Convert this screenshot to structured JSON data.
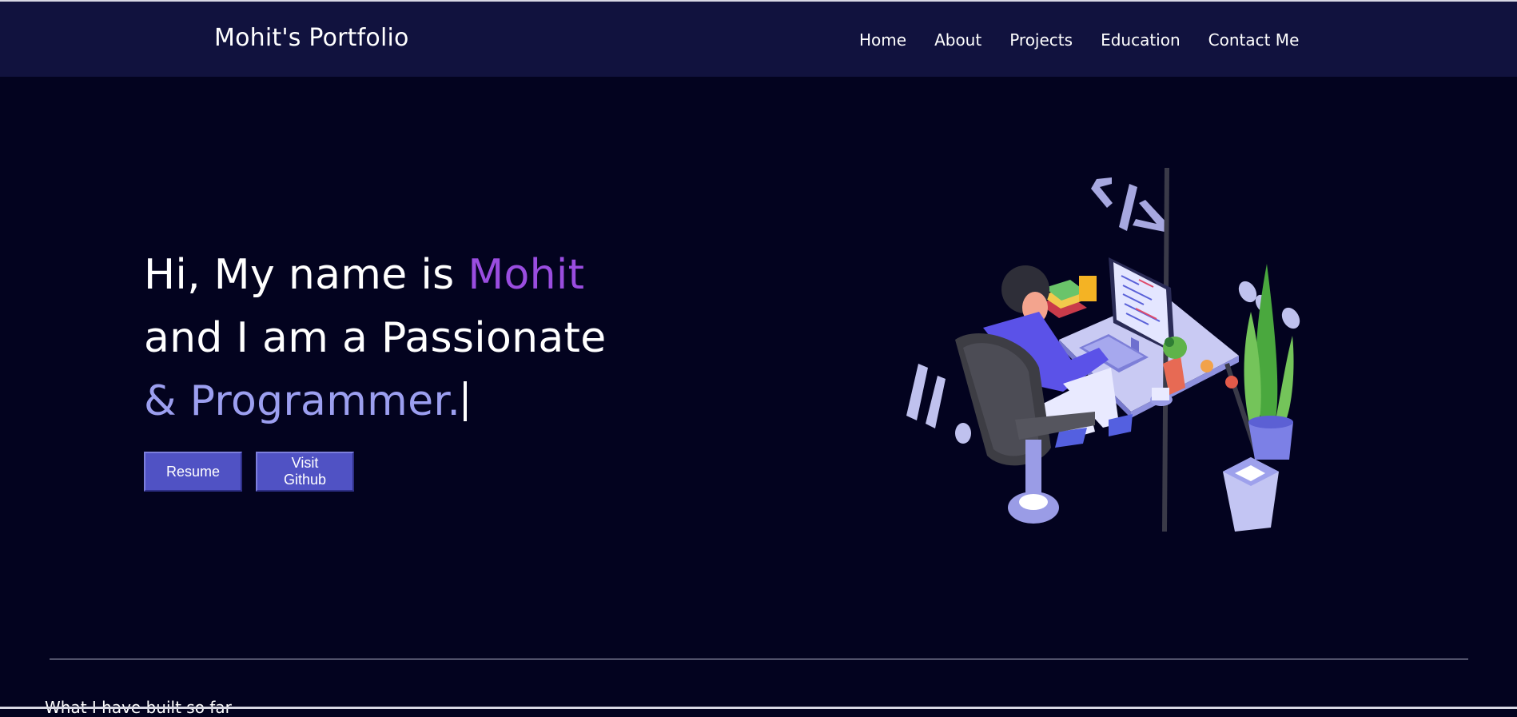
{
  "header": {
    "brand": "Mohit's Portfolio",
    "nav": [
      {
        "label": "Home"
      },
      {
        "label": "About"
      },
      {
        "label": "Projects"
      },
      {
        "label": "Education"
      },
      {
        "label": "Contact Me"
      }
    ]
  },
  "hero": {
    "line1_prefix": "Hi, My name is ",
    "line1_name": "Mohit",
    "line2": "and I am a Passionate",
    "line3": "& Programmer.",
    "buttons": {
      "resume": "Resume",
      "github": "Visit Github"
    },
    "illustration": "developer-at-desk-illustration"
  },
  "footer_peek": {
    "text": "What I have built so far"
  },
  "colors": {
    "background": "#03031f",
    "header": "#11123e",
    "accent_purple": "#9a4de0",
    "soft_lavender": "#9c9ff0",
    "button": "#5052c4"
  }
}
